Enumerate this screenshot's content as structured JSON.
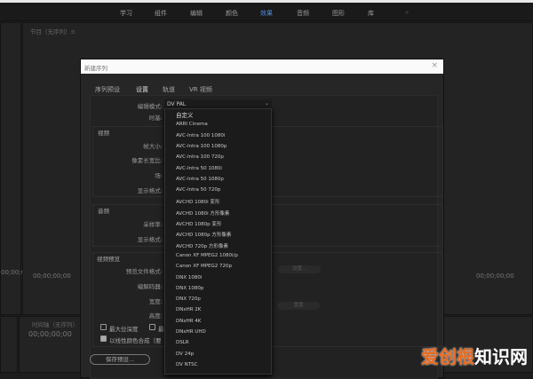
{
  "workspaces": [
    {
      "label": "学习"
    },
    {
      "label": "组件"
    },
    {
      "label": "编辑"
    },
    {
      "label": "颜色"
    },
    {
      "label": "效果",
      "active": true
    },
    {
      "label": "音频"
    },
    {
      "label": "图形"
    },
    {
      "label": "库"
    }
  ],
  "more_label": "»",
  "program_panel": {
    "title": "节目（无序列）≡"
  },
  "timecodes": {
    "left": "00;00;0",
    "source": "00;00;00;00",
    "right": "00;00;00;00",
    "timeline": "00;00;00;00"
  },
  "timeline": {
    "title": "时间轴（无序列）"
  },
  "dialog": {
    "title": "新建序列",
    "close": "×",
    "tabs": [
      {
        "label": "序列预设"
      },
      {
        "label": "设置",
        "active": true
      },
      {
        "label": "轨道"
      },
      {
        "label": "VR 视频"
      }
    ],
    "edit_mode_label": "编辑模式:",
    "edit_mode_value": "DV PAL",
    "timebase_label": "时基:",
    "video_section": "视频",
    "frame_size_label": "帧大小:",
    "pixel_aspect_label": "像素长宽比:",
    "fields_label": "场:",
    "display_format_label": "显示格式:",
    "audio_section": "音频",
    "sample_rate_label": "采样率:",
    "audio_display_format_label": "显示格式:",
    "preview_section": "视频预览",
    "preview_format_label": "预览文件格式:",
    "codec_label": "编解码器:",
    "width_label": "宽度:",
    "height_label": "高度:",
    "configure_button": "设置...",
    "reset_button": "重置",
    "max_bit_depth": {
      "label": "最大位深度",
      "checked": false
    },
    "max_render": {
      "label": "最",
      "checked": false
    },
    "linear_color": {
      "label": "以线性颜色合成（要",
      "checked": true
    },
    "save_preset": "保存预设..."
  },
  "dropdown_options": [
    "自定义",
    "ARRI Cinema",
    "AVC-Intra 100 1080i",
    "AVC-Intra 100 1080p",
    "AVC-Intra 100 720p",
    "AVC-Intra 50 1080i",
    "AVC-Intra 50 1080p",
    "AVC-Intra 50 720p",
    "AVCHD 1080i 变形",
    "AVCHD 1080i 方形像素",
    "AVCHD 1080p 变形",
    "AVCHD 1080p 方形像素",
    "AVCHD 720p 方形像素",
    "Canon XF MPEG2 1080i/p",
    "Canon XF MPEG2 720p",
    "DNX 1080i",
    "DNX 1080p",
    "DNX 720p",
    "DNxHR 2K",
    "DNxHR 4K",
    "DNxHR UHD",
    "DSLR",
    "DV 24p",
    "DV NTSC"
  ],
  "watermark": {
    "part1": "爱创根",
    "part2": "知识网"
  },
  "colors": {
    "accent": "#4a8fe0",
    "watermark": "#e86a1f"
  }
}
